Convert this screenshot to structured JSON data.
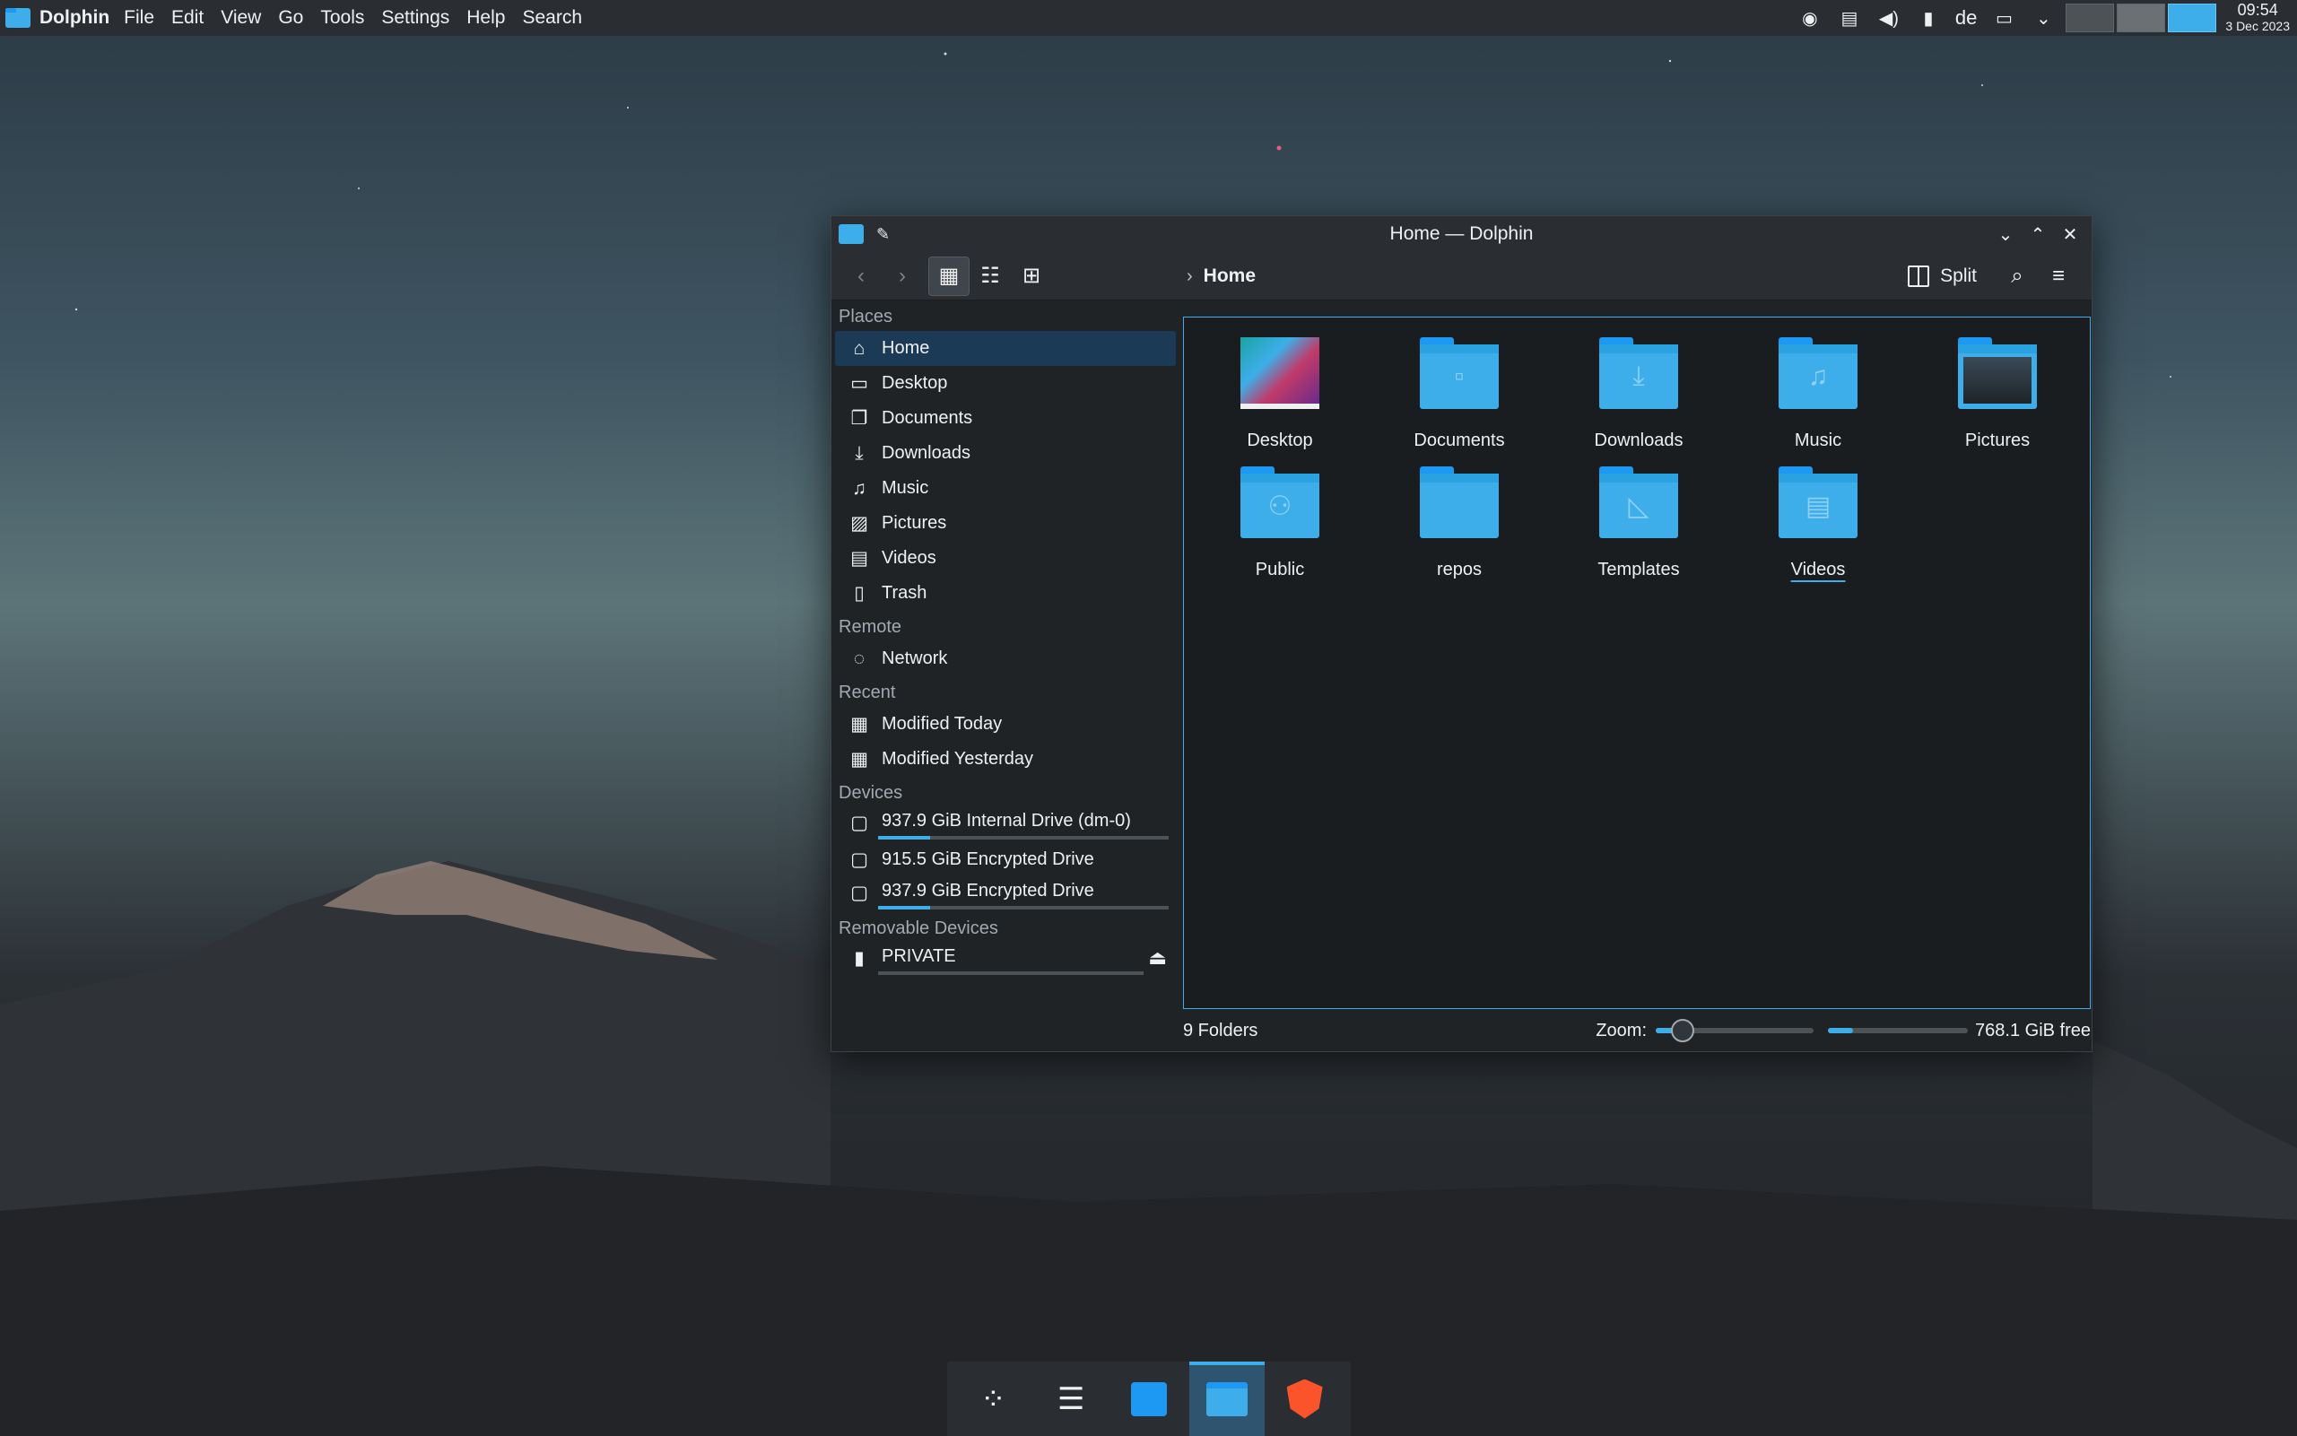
{
  "topbar": {
    "app_name": "Dolphin",
    "menu": [
      "File",
      "Edit",
      "View",
      "Go",
      "Tools",
      "Settings",
      "Help",
      "Search"
    ],
    "tray": {
      "icons": [
        "discord-icon",
        "clipboard-icon",
        "volume-icon",
        "usb-drive-icon"
      ],
      "keyboard_layout": "de",
      "icons_after": [
        "network-icon",
        "chevron-down-icon"
      ],
      "clock_time": "09:54",
      "clock_date": "3 Dec 2023"
    }
  },
  "window": {
    "title": "Home — Dolphin",
    "breadcrumb": "Home",
    "split_label": "Split",
    "sidebar": {
      "sections": [
        {
          "heading": "Places",
          "items": [
            {
              "label": "Home",
              "icon": "home-icon",
              "glyph": "⌂",
              "selected": true
            },
            {
              "label": "Desktop",
              "icon": "desktop-icon",
              "glyph": "▭"
            },
            {
              "label": "Documents",
              "icon": "documents-icon",
              "glyph": "❐"
            },
            {
              "label": "Downloads",
              "icon": "downloads-icon",
              "glyph": "⤓"
            },
            {
              "label": "Music",
              "icon": "music-icon",
              "glyph": "♫"
            },
            {
              "label": "Pictures",
              "icon": "pictures-icon",
              "glyph": "▨"
            },
            {
              "label": "Videos",
              "icon": "videos-icon",
              "glyph": "▤"
            },
            {
              "label": "Trash",
              "icon": "trash-icon",
              "glyph": "▯"
            }
          ]
        },
        {
          "heading": "Remote",
          "items": [
            {
              "label": "Network",
              "icon": "network-icon",
              "glyph": "◌"
            }
          ]
        },
        {
          "heading": "Recent",
          "items": [
            {
              "label": "Modified Today",
              "icon": "calendar-icon",
              "glyph": "▦"
            },
            {
              "label": "Modified Yesterday",
              "icon": "calendar-icon",
              "glyph": "▦"
            }
          ]
        },
        {
          "heading": "Devices",
          "items": [
            {
              "label": "937.9 GiB Internal Drive (dm-0)",
              "icon": "drive-icon",
              "glyph": "▢",
              "usage": 0.18
            },
            {
              "label": "915.5 GiB Encrypted Drive",
              "icon": "encrypted-drive-icon",
              "glyph": "▢"
            },
            {
              "label": "937.9 GiB Encrypted Drive",
              "icon": "encrypted-drive-icon",
              "glyph": "▢",
              "usage": 0.18
            }
          ]
        },
        {
          "heading": "Removable Devices",
          "items": [
            {
              "label": "PRIVATE",
              "icon": "usb-drive-icon",
              "glyph": "▮",
              "usage": 0.0,
              "eject": true
            }
          ]
        }
      ]
    },
    "files": [
      {
        "name": "Desktop",
        "type": "desktop",
        "glyph": ""
      },
      {
        "name": "Documents",
        "type": "folder",
        "glyph": "▫"
      },
      {
        "name": "Downloads",
        "type": "folder",
        "glyph": "⤓"
      },
      {
        "name": "Music",
        "type": "folder",
        "glyph": "♫"
      },
      {
        "name": "Pictures",
        "type": "pictures",
        "glyph": ""
      },
      {
        "name": "Public",
        "type": "folder",
        "glyph": "⚇"
      },
      {
        "name": "repos",
        "type": "folder",
        "glyph": ""
      },
      {
        "name": "Templates",
        "type": "folder",
        "glyph": "◺"
      },
      {
        "name": "Videos",
        "type": "folder",
        "glyph": "▤",
        "hovered": true
      }
    ],
    "status": {
      "count": "9 Folders",
      "zoom_label": "Zoom:",
      "zoom_level": 0.17,
      "space_used": 0.18,
      "free": "768.1 GiB free"
    }
  },
  "dock": {
    "items": [
      "app-launcher-icon",
      "system-settings-icon",
      "discover-store-icon",
      "dolphin-icon",
      "brave-browser-icon"
    ]
  },
  "colors": {
    "accent": "#3daee9",
    "panel": "#2a2e32",
    "window_bg": "#202326"
  }
}
